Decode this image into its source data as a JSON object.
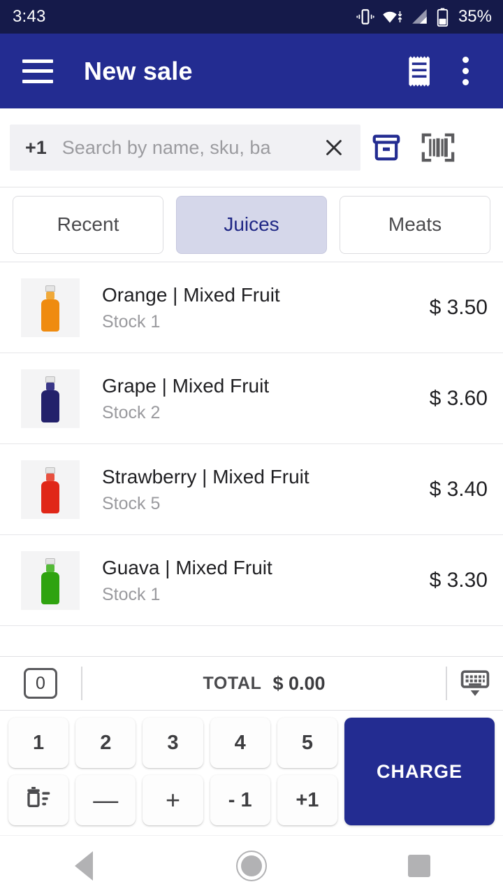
{
  "statusbar": {
    "time": "3:43",
    "battery": "35%",
    "icons": [
      "vibrate-icon",
      "wifi-icon",
      "cell-signal-icon",
      "battery-icon"
    ],
    "background": "#151a4a"
  },
  "appbar": {
    "title": "New sale",
    "menu_icon": "hamburger-menu-icon",
    "receipt_icon": "receipt-icon",
    "overflow_icon": "more-vertical-icon",
    "background": "#232c91"
  },
  "search": {
    "prefix": "+1",
    "value": "",
    "placeholder": "Search by name, sku, ba",
    "clear_icon": "close-icon",
    "archive_icon": "archive-box-icon",
    "barcode_icon": "barcode-scanner-icon"
  },
  "tabs": [
    {
      "label": "Recent",
      "active": false
    },
    {
      "label": "Juices",
      "active": true
    },
    {
      "label": "Meats",
      "active": false
    }
  ],
  "products": [
    {
      "name": "Orange | Mixed Fruit",
      "stock": "Stock 1",
      "price": "$ 3.50",
      "color": "#ef8b10",
      "neck": "#f0a93a",
      "image": "orange-juice-bottle"
    },
    {
      "name": "Grape | Mixed Fruit",
      "stock": "Stock 2",
      "price": "$ 3.60",
      "color": "#23216b",
      "neck": "#3a3788",
      "image": "grape-juice-bottle"
    },
    {
      "name": "Strawberry | Mixed Fruit",
      "stock": "Stock 5",
      "price": "$ 3.40",
      "color": "#e02718",
      "neck": "#e8503f",
      "image": "strawberry-juice-bottle"
    },
    {
      "name": "Guava | Mixed Fruit",
      "stock": "Stock 1",
      "price": "$ 3.30",
      "color": "#2fa310",
      "neck": "#54ba37",
      "image": "guava-juice-bottle"
    }
  ],
  "totalbar": {
    "quantity": "0",
    "total_label": "TOTAL",
    "total_value": "$ 0.00",
    "keyboard_icon": "hide-keyboard-icon"
  },
  "keypad": {
    "keys_row1": [
      "1",
      "2",
      "3",
      "4",
      "5"
    ],
    "keys_row2": [
      "delete-icon",
      "—",
      "+",
      "- 1",
      "+1"
    ],
    "delete_icon": "trash-list-icon",
    "charge_label": "CHARGE",
    "charge_color": "#232c91"
  },
  "navbar": {
    "back": "back-triangle-icon",
    "home": "home-circle-icon",
    "recents": "recents-square-icon"
  }
}
